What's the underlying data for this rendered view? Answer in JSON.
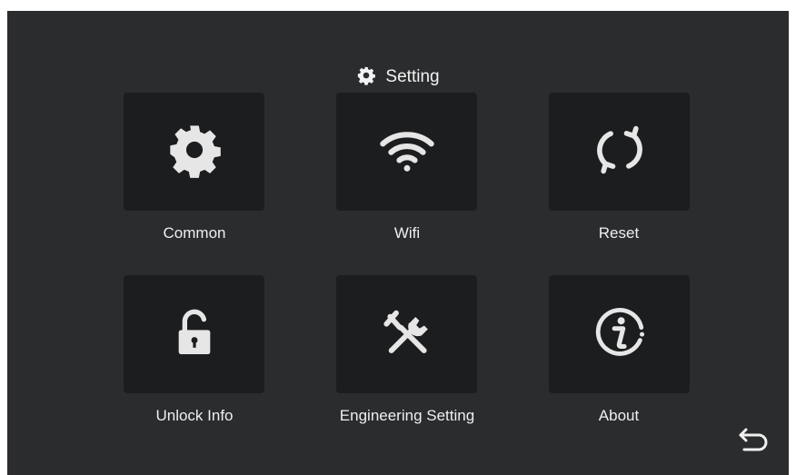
{
  "header": {
    "title": "Setting",
    "icon": "gear-icon"
  },
  "tiles": [
    {
      "label": "Common",
      "icon": "gear-icon"
    },
    {
      "label": "Wifi",
      "icon": "wifi-icon"
    },
    {
      "label": "Reset",
      "icon": "refresh-icon"
    },
    {
      "label": "Unlock Info",
      "icon": "unlock-icon"
    },
    {
      "label": "Engineering Setting",
      "icon": "tools-icon"
    },
    {
      "label": "About",
      "icon": "info-icon"
    }
  ],
  "back": {
    "icon": "back-arrow-icon"
  },
  "colors": {
    "background": "#2b2c2d",
    "tile": "#1c1d1e",
    "icon": "#e6e6e6",
    "text": "#efefef"
  }
}
